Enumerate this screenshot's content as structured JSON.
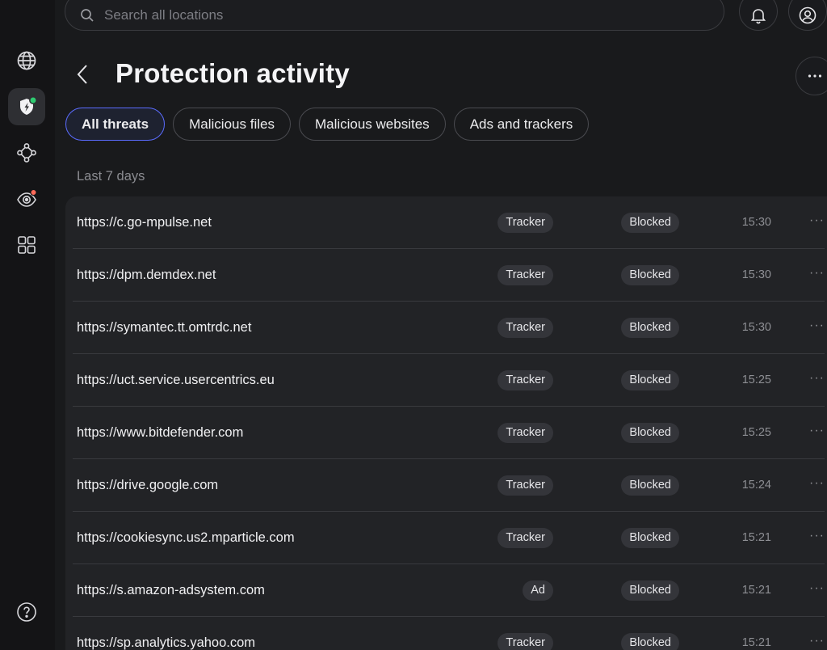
{
  "search": {
    "placeholder": "Search all locations"
  },
  "sidebar": {
    "items": [
      {
        "name": "globe-icon",
        "active": false
      },
      {
        "name": "shield-icon",
        "active": true
      },
      {
        "name": "network-icon",
        "active": false
      },
      {
        "name": "eye-icon",
        "active": false
      },
      {
        "name": "apps-grid-icon",
        "active": false
      }
    ],
    "help_icon": "help-icon"
  },
  "header": {
    "title": "Protection activity"
  },
  "tabs": [
    {
      "label": "All threats",
      "active": true
    },
    {
      "label": "Malicious files",
      "active": false
    },
    {
      "label": "Malicious websites",
      "active": false
    },
    {
      "label": "Ads and trackers",
      "active": false
    }
  ],
  "section": {
    "label": "Last 7 days"
  },
  "rows": [
    {
      "url": "https://c.go-mpulse.net",
      "type": "Tracker",
      "status": "Blocked",
      "time": "15:30"
    },
    {
      "url": "https://dpm.demdex.net",
      "type": "Tracker",
      "status": "Blocked",
      "time": "15:30"
    },
    {
      "url": "https://symantec.tt.omtrdc.net",
      "type": "Tracker",
      "status": "Blocked",
      "time": "15:30"
    },
    {
      "url": "https://uct.service.usercentrics.eu",
      "type": "Tracker",
      "status": "Blocked",
      "time": "15:25"
    },
    {
      "url": "https://www.bitdefender.com",
      "type": "Tracker",
      "status": "Blocked",
      "time": "15:25"
    },
    {
      "url": "https://drive.google.com",
      "type": "Tracker",
      "status": "Blocked",
      "time": "15:24"
    },
    {
      "url": "https://cookiesync.us2.mparticle.com",
      "type": "Tracker",
      "status": "Blocked",
      "time": "15:21"
    },
    {
      "url": "https://s.amazon-adsystem.com",
      "type": "Ad",
      "status": "Blocked",
      "time": "15:21"
    },
    {
      "url": "https://sp.analytics.yahoo.com",
      "type": "Tracker",
      "status": "Blocked",
      "time": "15:21"
    }
  ],
  "colors": {
    "accent": "#5b6cff",
    "status_ok": "#2ecc71",
    "alert": "#ff6b5a"
  }
}
